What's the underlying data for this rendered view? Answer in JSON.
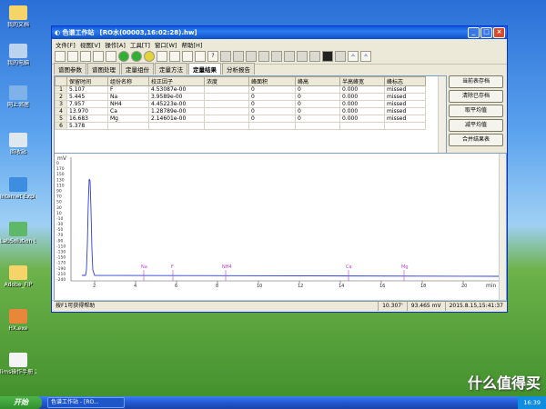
{
  "desktop": {
    "icons": [
      "我的文档",
      "我的电脑",
      "网上邻居",
      "回收站",
      "Internet Explorer",
      "LabSolution ULTRA 3.0",
      "Adobe_FIP",
      "HX.exe",
      "lims操作手册 221-0C1-6..."
    ]
  },
  "window": {
    "app_name": "色谱工作站",
    "title": "[RO水(00003,16:02:28).hw]",
    "menu": [
      "文件[F]",
      "视图[V]",
      "操作[A]",
      "工具[T]",
      "窗口[W]",
      "帮助[H]"
    ],
    "tabs": [
      "谱图参数",
      "谱图处理",
      "定量组份",
      "定量方法",
      "定量结果",
      "分析报告"
    ],
    "active_tab": "定量结果",
    "table": {
      "headers": [
        "保留时间",
        "组份名称",
        "校正因子",
        "浓度",
        "峰面积",
        "峰高",
        "半高峰宽",
        "峰标志"
      ],
      "rows": [
        [
          "1",
          "5.107",
          "F",
          "4.53087e-00",
          "0",
          "0",
          "0.000",
          "missed"
        ],
        [
          "2",
          "5.445",
          "Na",
          "3.9589e-00",
          "0",
          "0",
          "0.000",
          "missed"
        ],
        [
          "3",
          "7.957",
          "NH4",
          "4.45223e-00",
          "0",
          "0",
          "0.000",
          "missed"
        ],
        [
          "4",
          "13.970",
          "Ca",
          "1.28789e-00",
          "0",
          "0",
          "0.000",
          "missed"
        ],
        [
          "5",
          "16.683",
          "Mg",
          "2.14601e-00",
          "0",
          "0",
          "0.000",
          "missed"
        ],
        [
          "6",
          "5.378",
          "",
          "",
          "",
          "",
          "",
          ""
        ]
      ]
    },
    "side_buttons": [
      "当前表存档",
      "清除已存档",
      "取平均值",
      "减平均值",
      "合并结果表"
    ],
    "chart": {
      "ylabel": "mV",
      "yticks": [
        "0",
        "170",
        "150",
        "130",
        "110",
        "90",
        "70",
        "50",
        "30",
        "10",
        "-10",
        "-30",
        "-50",
        "-70",
        "-90",
        "-110",
        "-130",
        "-150",
        "-170",
        "-190",
        "-210",
        "-240"
      ],
      "xticks": [
        "2",
        "4",
        "6",
        "8",
        "10",
        "12",
        "14",
        "16",
        "18",
        "20"
      ],
      "xunit": "min",
      "peak_labels": [
        "Na",
        "F",
        "NH4",
        "Ca",
        "Mg"
      ]
    },
    "status": {
      "help": "按F1可获得帮助",
      "time": "10.307'",
      "value": "93.465 mV",
      "datetime": "2015.8.15,15:41:37"
    }
  },
  "taskbar": {
    "start": "开始",
    "item": "色谱工作站 - [RO...",
    "clock": "16:39"
  },
  "watermark": "什么值得买"
}
